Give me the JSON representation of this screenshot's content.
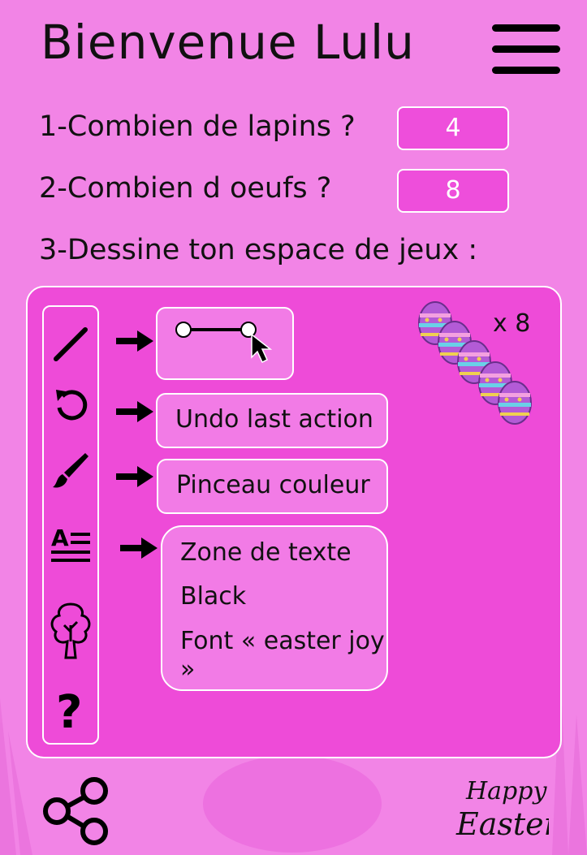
{
  "header": {
    "title": "Bienvenue Lulu",
    "menu_icon": "hamburger-menu-icon"
  },
  "questions": [
    {
      "label": "1-Combien de lapins ?",
      "answer": "4"
    },
    {
      "label": "2-Combien d oeufs ?",
      "answer": "8"
    }
  ],
  "drawing": {
    "prompt": "3-Dessine ton espace de jeux :",
    "tools": [
      "line-tool-icon",
      "undo-icon",
      "brush-icon",
      "text-format-icon",
      "tree-icon",
      "help-icon"
    ],
    "undo_label": "Undo last action",
    "brush_label": "Pinceau couleur",
    "text_zone": {
      "title": "Zone de texte",
      "color": "Black",
      "font": "Font « easter joy »"
    },
    "egg_count": "x 8"
  },
  "footer": {
    "share_icon": "share-icon",
    "badge_line1": "Happy",
    "badge_line2": "Easter"
  },
  "colors": {
    "background": "#f284e6",
    "panel": "#ee4bd8",
    "answer_box": "#ee4edb",
    "accent": "#ffffff"
  }
}
